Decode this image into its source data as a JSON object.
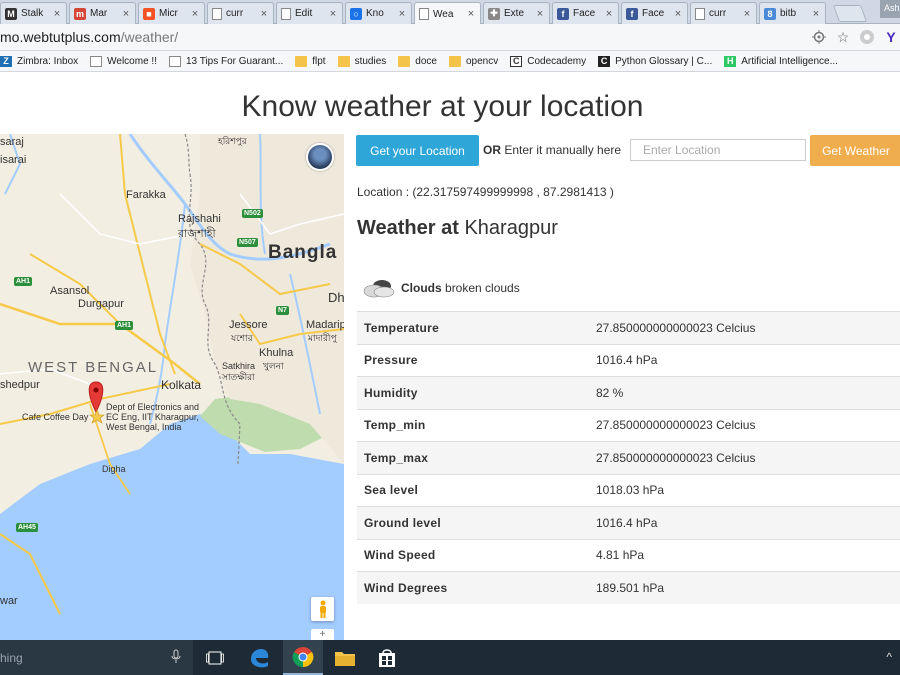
{
  "browser": {
    "tabs": [
      {
        "label": "Stalk",
        "color": "#333333",
        "glyph": "M"
      },
      {
        "label": "Mar",
        "color": "#d44638",
        "glyph": "m"
      },
      {
        "label": "Micr",
        "color": "#f35325",
        "glyph": "■"
      },
      {
        "label": "curr",
        "color": "#ffffff",
        "glyph": ""
      },
      {
        "label": "Edit",
        "color": "#ffffff",
        "glyph": ""
      },
      {
        "label": "Kno",
        "color": "#1a73e8",
        "glyph": "○"
      },
      {
        "label": "Wea",
        "color": "#ffffff",
        "glyph": "",
        "active": true
      },
      {
        "label": "Exte",
        "color": "#888888",
        "glyph": "✚"
      },
      {
        "label": "Face",
        "color": "#3b5998",
        "glyph": "f"
      },
      {
        "label": "Face",
        "color": "#3b5998",
        "glyph": "f"
      },
      {
        "label": "curr",
        "color": "#ffffff",
        "glyph": ""
      },
      {
        "label": "bitb",
        "color": "#4a8ad6",
        "glyph": "8"
      }
    ],
    "profile_label": "Ash",
    "url_host": "mo.webtutplus.com",
    "url_path": "/weather/",
    "bookmarks": [
      {
        "label": "Zimbra: Inbox",
        "icon": "zimbra",
        "color": "#1f6fb5",
        "glyph": "Z"
      },
      {
        "label": "Welcome !!",
        "icon": "page",
        "color": "#ffffff",
        "glyph": ""
      },
      {
        "label": "13 Tips For Guarant...",
        "icon": "page",
        "color": "#ffffff",
        "glyph": ""
      },
      {
        "label": "flpt",
        "icon": "folder",
        "color": "#f3c34a",
        "glyph": ""
      },
      {
        "label": "studies",
        "icon": "folder",
        "color": "#f3c34a",
        "glyph": ""
      },
      {
        "label": "doce",
        "icon": "folder",
        "color": "#f3c34a",
        "glyph": ""
      },
      {
        "label": "opencv",
        "icon": "folder",
        "color": "#f3c34a",
        "glyph": ""
      },
      {
        "label": "Codecademy",
        "icon": "codecademy",
        "color": "#ffffff",
        "glyph": "C"
      },
      {
        "label": "Python Glossary | C...",
        "icon": "codecademy-dark",
        "color": "#222222",
        "glyph": "C"
      },
      {
        "label": "Artificial Intelligence...",
        "icon": "hackerrank",
        "color": "#2ec866",
        "glyph": "H"
      }
    ]
  },
  "page": {
    "title": "Know weather at your location",
    "get_location_label": "Get your Location",
    "or_label": "OR",
    "manual_label": "Enter it manually here",
    "location_placeholder": "Enter Location",
    "get_weather_label": "Get Weather",
    "location_text": "Location : (22.317597499999998 , 87.2981413 )",
    "weather_at_label": "Weather at",
    "city": "Kharagpur",
    "condition_main": "Clouds",
    "condition_desc": "broken clouds",
    "rows": [
      {
        "key": "Temperature",
        "value": "27.850000000000023 Celcius"
      },
      {
        "key": "Pressure",
        "value": "1016.4 hPa"
      },
      {
        "key": "Humidity",
        "value": "82 %"
      },
      {
        "key": "Temp_min",
        "value": "27.850000000000023 Celcius"
      },
      {
        "key": "Temp_max",
        "value": "27.850000000000023 Celcius"
      },
      {
        "key": "Sea level",
        "value": "1018.03 hPa"
      },
      {
        "key": "Ground level",
        "value": "1016.4 hPa"
      },
      {
        "key": "Wind Speed",
        "value": "4.81 hPa"
      },
      {
        "key": "Wind Degrees",
        "value": "189.501 hPa"
      }
    ]
  },
  "map": {
    "labels": {
      "durgapur_top": "Durgapur",
      "farakka": "Farakka",
      "rajshahi": "Rajshahi",
      "rajshahi_bn": "রাজশাহী",
      "bangladesh": "Bangla",
      "dh": "Dh",
      "asansol": "Asansol",
      "durgapur": "Durgapur",
      "west_bengal": "WEST BENGAL",
      "jessore": "Jessore",
      "jessore_bn": "যশোর",
      "madaripur": "Madarip",
      "madaripur_bn": "মাদারীপু",
      "khulna": "Khulna",
      "khulna_bn": "খুলনা",
      "satkhira": "Satkhira",
      "satkhira_bn": "সাতক্ষীরা",
      "kolkata": "Kolkata",
      "jamshedpur": "shedpur",
      "cafe": "Cafe Coffee Day",
      "marker_line1": "Dept of Electronics and",
      "marker_line2": "EC Eng, IIT Kharagpur,",
      "marker_line3": "West Bengal, India",
      "digha": "Digha",
      "asarai": "saraj",
      "isarai": "isarai",
      "war": "war",
      "khurj": "হরিশপুর"
    },
    "highways": {
      "n502": "N502",
      "n507": "N507",
      "ah1_a": "AH1",
      "ah1_b": "AH1",
      "n7": "N7",
      "ah45": "AH45"
    },
    "zoom_label": "+"
  },
  "taskbar": {
    "search_text": "hing"
  }
}
